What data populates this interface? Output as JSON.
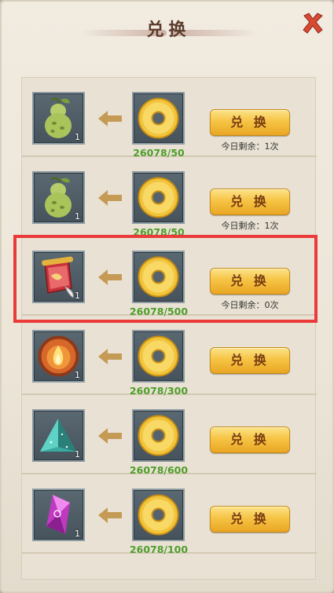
{
  "header": {
    "title": "兑换"
  },
  "rows": [
    {
      "item_icon": "pear-icon",
      "item_count": "1",
      "currency_icon": "gold-coin-icon",
      "cost": "26078/50",
      "button_label": "兑 换",
      "remaining": "今日剩余：1次"
    },
    {
      "item_icon": "pear-icon",
      "item_count": "1",
      "currency_icon": "gold-coin-icon",
      "cost": "26078/50",
      "button_label": "兑 换",
      "remaining": "今日剩余：1次"
    },
    {
      "item_icon": "scroll-icon",
      "item_count": "1",
      "currency_icon": "gold-coin-icon",
      "cost": "26078/500",
      "button_label": "兑 换",
      "remaining": "今日剩余：0次"
    },
    {
      "item_icon": "fire-orb-icon",
      "item_count": "1",
      "currency_icon": "gold-coin-icon",
      "cost": "26078/300",
      "button_label": "兑 换",
      "remaining": ""
    },
    {
      "item_icon": "crystal-pile-icon",
      "item_count": "1",
      "currency_icon": "gold-coin-icon",
      "cost": "26078/600",
      "button_label": "兑 换",
      "remaining": ""
    },
    {
      "item_icon": "purple-gem-icon",
      "item_count": "1",
      "currency_icon": "gold-coin-icon",
      "cost": "26078/100",
      "button_label": "兑 换",
      "remaining": ""
    }
  ],
  "colors": {
    "cost_text": "#4e9d2a",
    "button_gold": "#f6c445",
    "highlight": "#ea3a3a",
    "close": "#d84a33"
  }
}
